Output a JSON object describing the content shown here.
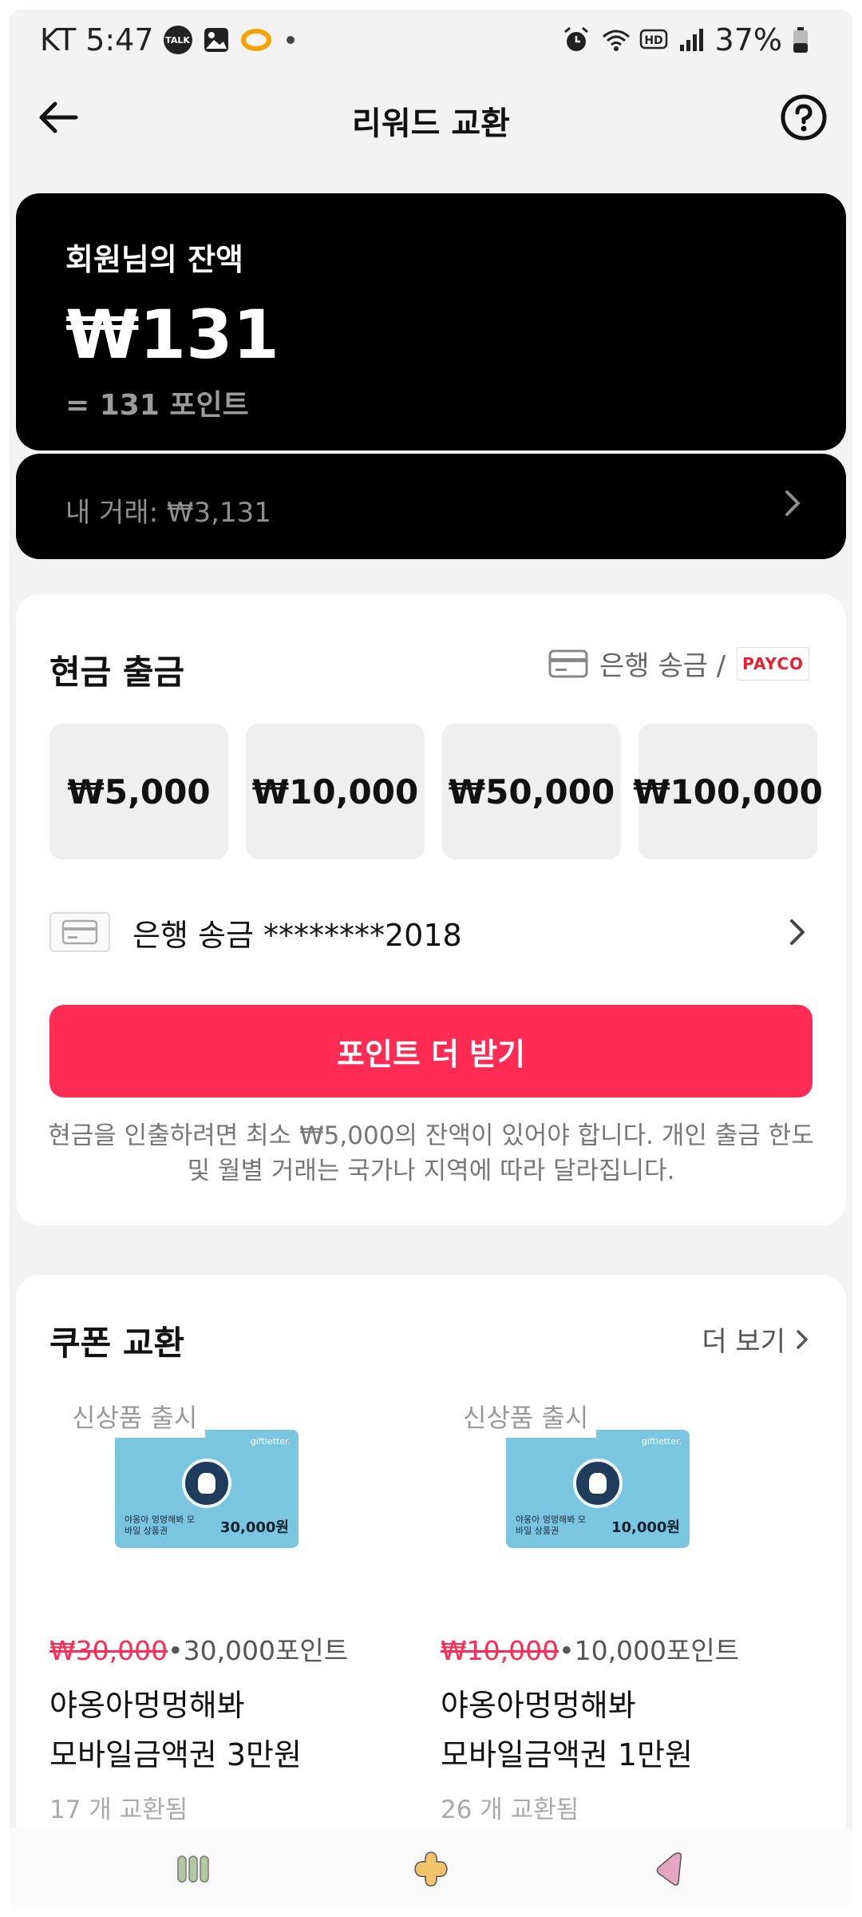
{
  "status_bar": {
    "carrier": "KT",
    "time": "5:47",
    "talk_label": "TALK",
    "battery": "37%"
  },
  "header": {
    "title": "리워드 교환"
  },
  "balance": {
    "label": "회원님의 잔액",
    "amount": "₩131",
    "points": "= 131 포인트",
    "transactions": "내 거래: ₩3,131"
  },
  "cash": {
    "title": "현금 출금",
    "method_label": "은행 송금 /",
    "payco": "PAYCO",
    "amounts": [
      "₩5,000",
      "₩10,000",
      "₩50,000",
      "₩100,000"
    ],
    "bank_account": "은행 송금 ********2018",
    "button": "포인트 더 받기",
    "notice": "현금을 인출하려면 최소 ₩5,000의 잔액이 있어야 합니다. 개인 출금 한도 및 월별 거래는 국가나 지역에 따라 달라집니다."
  },
  "coupons": {
    "title": "쿠폰 교환",
    "more": "더 보기",
    "items": [
      {
        "badge": "신상품 출시",
        "brand": "giftletter.",
        "card_name": "야옹아 멍멍해봐 모바일 상품권",
        "card_value": "30,000원",
        "old_price": "₩30,000",
        "points": "•30,000포인트",
        "name_line1": "야옹아멍멍해봐",
        "name_line2": "모바일금액권 3만원",
        "exchanged": "17 개 교환됨"
      },
      {
        "badge": "신상품 출시",
        "brand": "giftletter.",
        "card_name": "야옹아 멍멍해봐 모바일 상품권",
        "card_value": "10,000원",
        "old_price": "₩10,000",
        "points": "•10,000포인트",
        "name_line1": "야옹아멍멍해봐",
        "name_line2": "모바일금액권 1만원",
        "exchanged": "26 개 교환됨"
      }
    ]
  },
  "colors": {
    "accent": "#fe2c55",
    "card_bg": "#000000",
    "gift_card": "#7ac5df"
  },
  "icons": [
    "back-arrow-icon",
    "help-icon",
    "chevron-right-icon",
    "bank-card-icon",
    "recent-apps-icon",
    "home-icon",
    "back-icon"
  ]
}
